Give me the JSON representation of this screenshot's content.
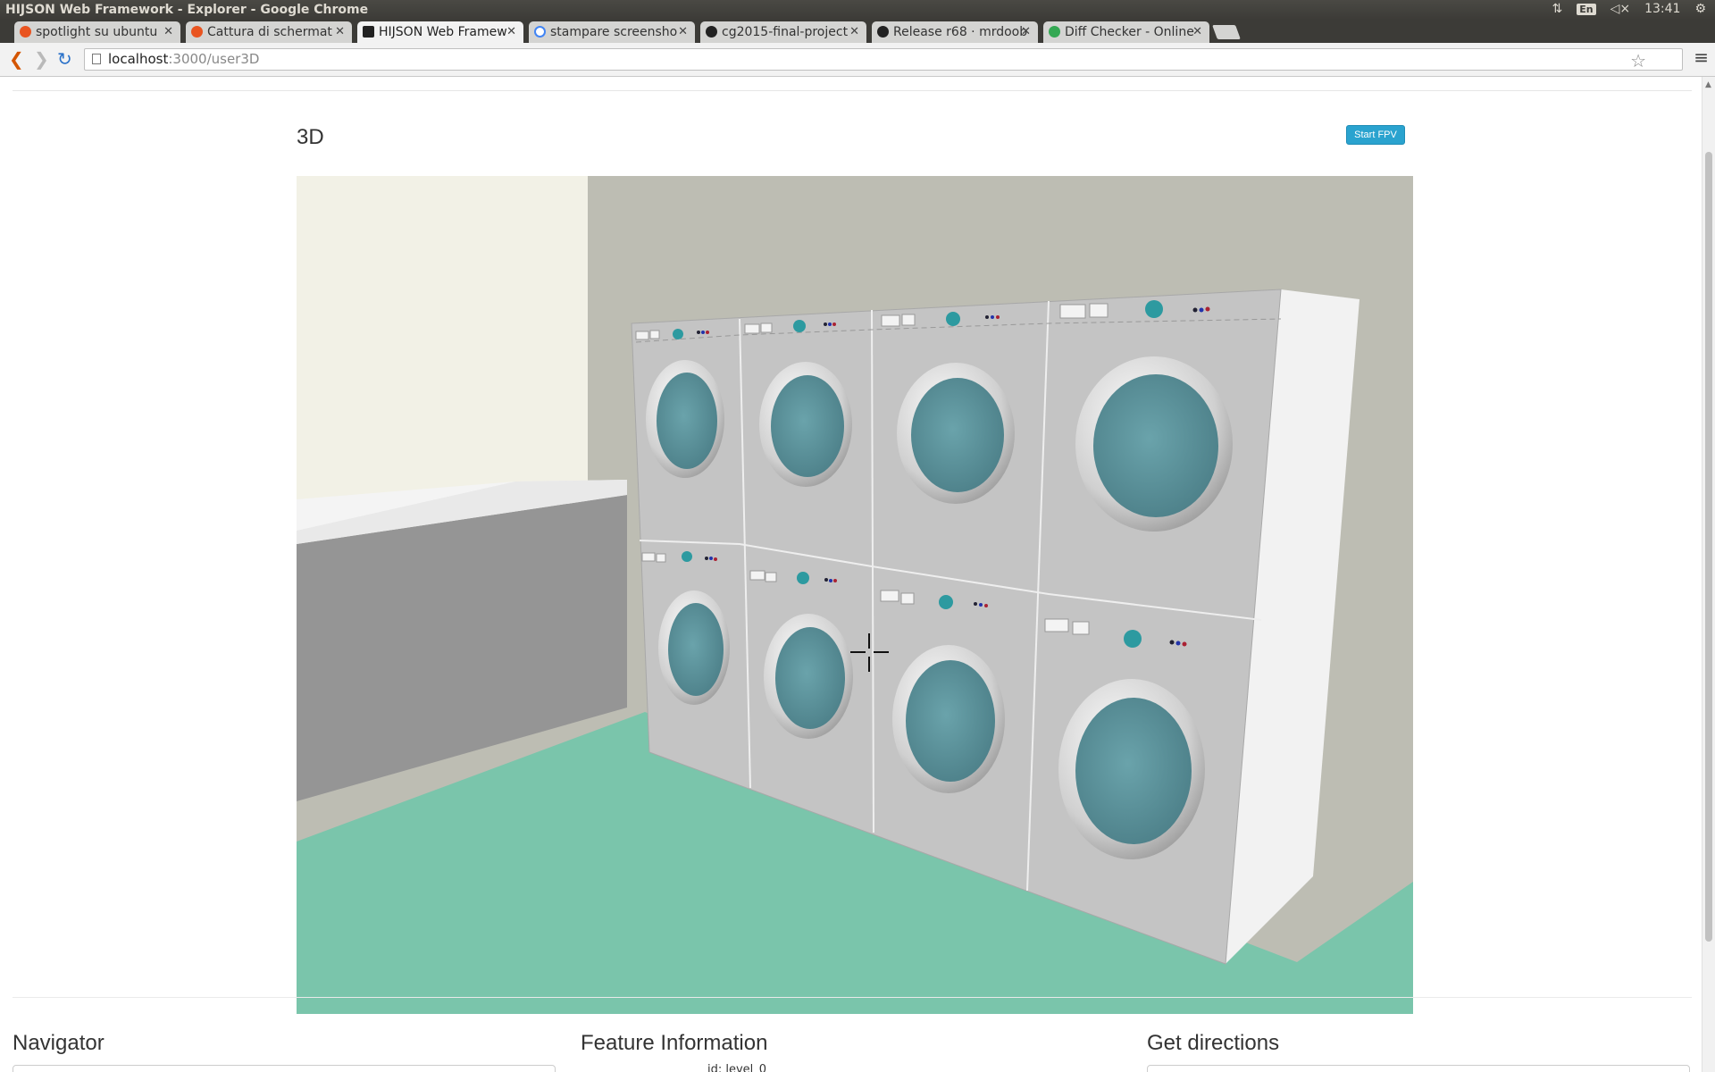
{
  "window": {
    "title": "HIJSON Web Framework - Explorer - Google Chrome"
  },
  "system_tray": {
    "lang": "En",
    "time": "13:41"
  },
  "tabs": [
    {
      "label": "spotlight su ubuntu",
      "favicon_color": "#e95420"
    },
    {
      "label": "Cattura di schermat",
      "favicon_color": "#e95420"
    },
    {
      "label": "HIJSON Web Framew",
      "favicon_color": "#222222",
      "active": true
    },
    {
      "label": "stampare screensho",
      "favicon_color": "#4285f4"
    },
    {
      "label": "cg2015-final-project",
      "favicon_color": "#222222"
    },
    {
      "label": "Release r68 · mrdoob",
      "favicon_color": "#222222"
    },
    {
      "label": "Diff Checker - Online",
      "favicon_color": "#34a853"
    }
  ],
  "address_bar": {
    "host": "localhost",
    "path": ":3000/user3D"
  },
  "main": {
    "title": "3D",
    "fpv_button": "Start FPV"
  },
  "panels": {
    "navigator": "Navigator",
    "feature_info": "Feature Information",
    "directions": "Get directions",
    "feature_partial": "id:   level_0"
  },
  "colors": {
    "floor": "#7ac5ab",
    "wall_back": "#bdbdb3",
    "wall_left": "#f2f1e6",
    "machine": "#c4c4c4",
    "door_glass": "#5a9199",
    "accent_button": "#2aa3cf"
  }
}
